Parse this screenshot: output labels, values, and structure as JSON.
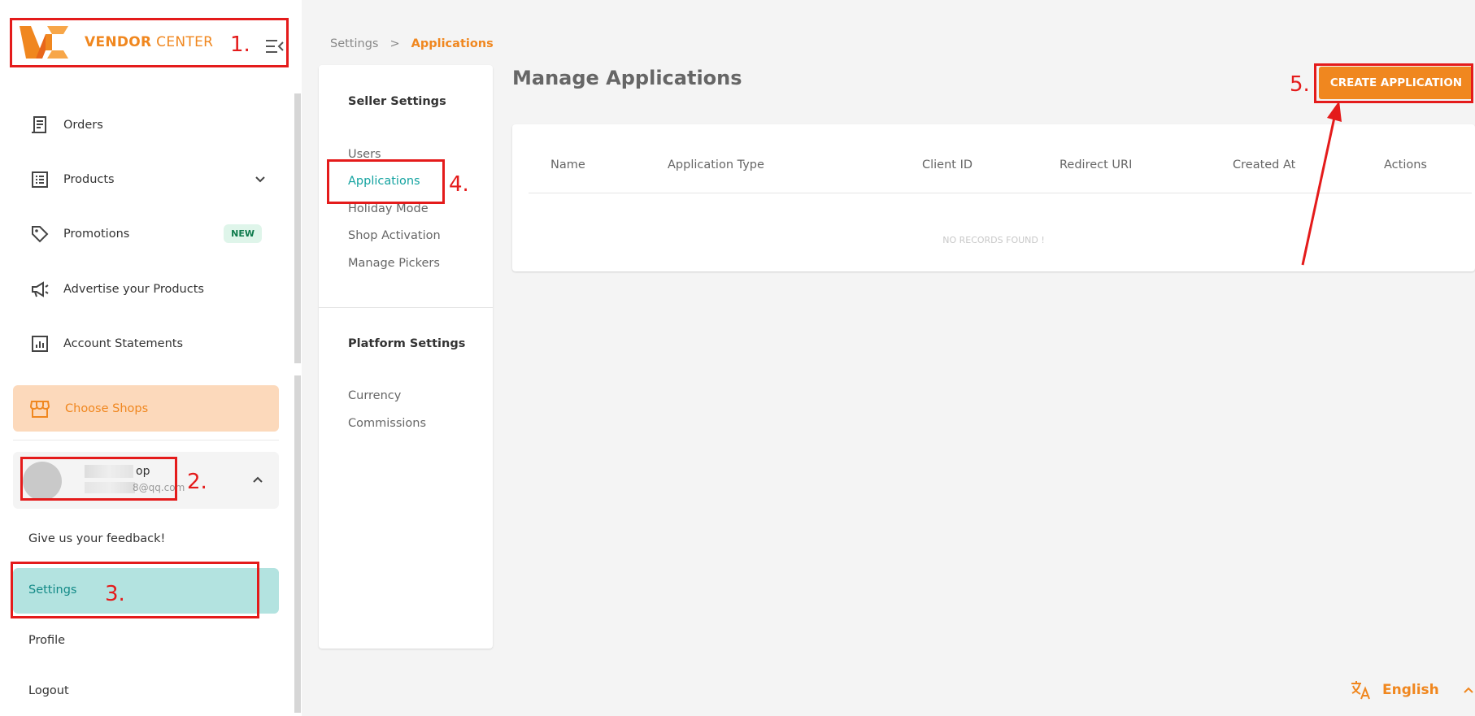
{
  "logo": {
    "word_vendor": "VENDOR",
    "word_center": "CENTER"
  },
  "sidebar": {
    "items": [
      {
        "label": "Orders",
        "icon": "receipt-icon"
      },
      {
        "label": "Products",
        "icon": "list-icon"
      },
      {
        "label": "Promotions",
        "icon": "tag-icon",
        "badge": "NEW"
      },
      {
        "label": "Advertise your Products",
        "icon": "megaphone-icon"
      },
      {
        "label": "Account Statements",
        "icon": "chart-icon"
      }
    ],
    "choose_shops": "Choose Shops",
    "user": {
      "name": "op",
      "email": "8@qq.com"
    },
    "feedback": "Give us your feedback!",
    "settings": "Settings",
    "profile": "Profile",
    "logout": "Logout"
  },
  "breadcrumb": {
    "root": "Settings",
    "separator": ">",
    "current": "Applications"
  },
  "settings_menu": {
    "seller_heading": "Seller Settings",
    "seller_items": [
      "Users",
      "Applications",
      "Holiday Mode",
      "Shop Activation",
      "Manage Pickers"
    ],
    "platform_heading": "Platform Settings",
    "platform_items": [
      "Currency",
      "Commissions"
    ]
  },
  "main": {
    "title": "Manage Applications",
    "create_button": "CREATE APPLICATION",
    "columns": [
      "Name",
      "Application Type",
      "Client ID",
      "Redirect URI",
      "Created At",
      "Actions"
    ],
    "empty_text": "NO RECORDS FOUND !"
  },
  "language": {
    "label": "English"
  },
  "annotations": [
    "1.",
    "2.",
    "3.",
    "4.",
    "5."
  ],
  "colors": {
    "accent": "#f0871f",
    "teal": "#14a3a0",
    "annotation": "#e41b1b"
  }
}
